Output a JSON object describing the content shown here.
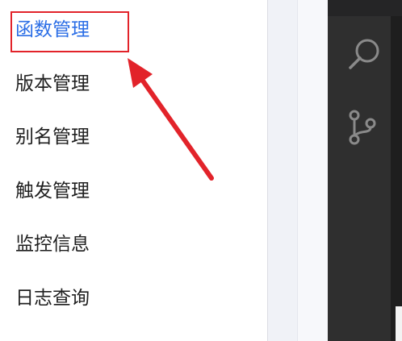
{
  "nav": {
    "items": [
      {
        "label": "函数管理",
        "active": true
      },
      {
        "label": "版本管理",
        "active": false
      },
      {
        "label": "别名管理",
        "active": false
      },
      {
        "label": "触发管理",
        "active": false
      },
      {
        "label": "监控信息",
        "active": false
      },
      {
        "label": "日志查询",
        "active": false
      }
    ]
  },
  "activity_bar": {
    "icons": [
      "search-icon",
      "source-control-icon"
    ]
  },
  "colors": {
    "active_text": "#2b6ee6",
    "text": "#1f1f1f",
    "annotation": "#e2232a",
    "activity_bar_bg": "#2f2f2f",
    "activity_icon": "#8a8a8a"
  }
}
